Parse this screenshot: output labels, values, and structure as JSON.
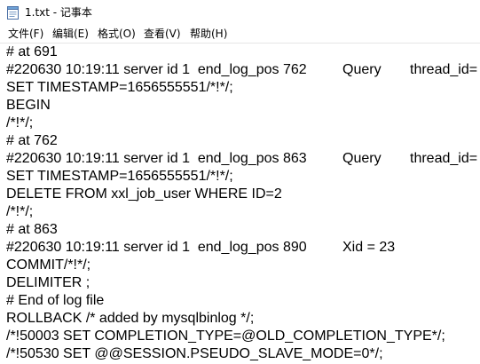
{
  "window": {
    "title": "1.txt - 记事本"
  },
  "menu": {
    "file": "文件(F)",
    "edit": "编辑(E)",
    "format": "格式(O)",
    "view": "查看(V)",
    "help": "帮助(H)"
  },
  "editor": {
    "lines": [
      "# at 691",
      "#220630 10:19:11 server id 1  end_log_pos 762",
      "SET TIMESTAMP=1656555551/*!*/;",
      "BEGIN",
      "/*!*/;",
      "# at 762",
      "#220630 10:19:11 server id 1  end_log_pos 863",
      "SET TIMESTAMP=1656555551/*!*/;",
      "DELETE FROM xxl_job_user WHERE ID=2",
      "/*!*/;",
      "# at 863",
      "#220630 10:19:11 server id 1  end_log_pos 890",
      "COMMIT/*!*/;",
      "DELIMITER ;",
      "# End of log file",
      "ROLLBACK /* added by mysqlbinlog */;",
      "/*!50003 SET COMPLETION_TYPE=@OLD_COMPLETION_TYPE*/;",
      "/*!50530 SET @@SESSION.PSEUDO_SLAVE_MODE=0*/;"
    ],
    "col2": {
      "line1": "Query",
      "line6": "Query",
      "line11": "Xid = 23"
    },
    "col3": {
      "line1": "thread_id=",
      "line6": "thread_id="
    }
  }
}
